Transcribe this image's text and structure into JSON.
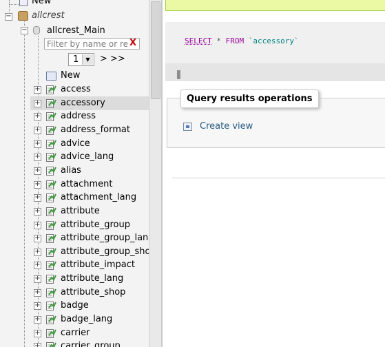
{
  "nav": {
    "top_new_label": "New",
    "server_label": "allcrest",
    "database_label": "allcrest_Main",
    "filter_placeholder": "Filter by name or regex",
    "filter_clear": "X",
    "pager_value": "1",
    "pager_next": "> >>",
    "new_table_label": "New",
    "selected_table": "accessory",
    "tables": [
      "access",
      "accessory",
      "address",
      "address_format",
      "advice",
      "advice_lang",
      "alias",
      "attachment",
      "attachment_lang",
      "attribute",
      "attribute_group",
      "attribute_group_lang",
      "attribute_group_shop",
      "attribute_impact",
      "attribute_lang",
      "attribute_shop",
      "badge",
      "badge_lang",
      "carrier",
      "carrier_group"
    ]
  },
  "main": {
    "sql": {
      "select": "SELECT",
      "star": "*",
      "from": "FROM",
      "table": "`accessory`"
    },
    "query_results_ops": {
      "legend": "Query results operations",
      "create_view": "Create view"
    }
  },
  "colors": {
    "success_bg": "#ebf8a4",
    "link": "#235a81",
    "sql_keyword": "#990099",
    "sql_identifier": "#008080",
    "filter_clear": "#c00000"
  }
}
